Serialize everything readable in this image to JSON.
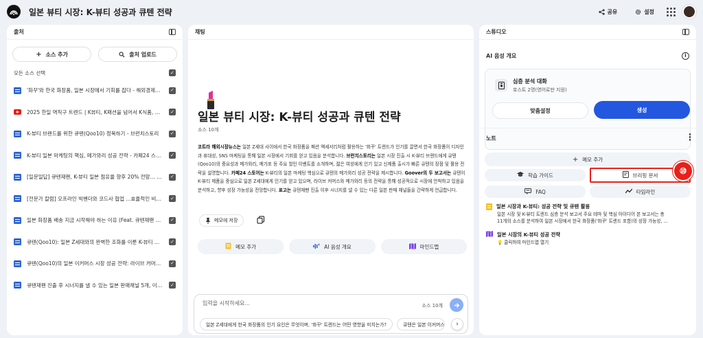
{
  "app": {
    "title": "일본 뷰티 시장: K-뷰티 성공과 큐텐 전략",
    "share_label": "공유",
    "settings_label": "설정"
  },
  "sources": {
    "header": "출처",
    "add_label": "소스 추가",
    "upload_label": "출처 업로드",
    "select_all": "모든 소스 선택",
    "items": [
      {
        "type": "doc",
        "label": "'화꾸'와 한국 화장품, 일본 시장에서 기회를 잡다 - 해외경제정..."
      },
      {
        "type": "youtube",
        "label": "2025 한일 역직구 트렌드 | K뷰티, K패션을 넘어서 K식품, K세..."
      },
      {
        "type": "doc",
        "label": "K-뷰티 브랜드를 위한 큐텐(Qoo10) 정복하기 - 브런치스토리"
      },
      {
        "type": "doc",
        "label": "K-뷰티 일본 마케팅의 핵심, 메가와리 성공 전략 - 카페24 스토..."
      },
      {
        "type": "doc",
        "label": "[일문일답] 큐텐재팬, K-뷰티 일본 점유율 향후 20% 전망... 인..."
      },
      {
        "type": "doc",
        "label": "[전문가 칼럼] 오프라인 빅벤더와 코드사 협업 ...효율적인 비..."
      },
      {
        "type": "doc",
        "label": "일본 화장품 배송 지금 시작해야 하는 이유 (Feat. 큐텐재팬 배..."
      },
      {
        "type": "doc",
        "label": "큐텐(Qoo10): 일본 Z세대와의 완벽한 조화를 이룬 K-뷰티 라..."
      },
      {
        "type": "doc",
        "label": "큐텐(Qoo10)의 일본 이커머스 시장 성공 전략: 라이브 커머스..."
      },
      {
        "type": "doc",
        "label": "큐텐재팬 진출 후 시너지를 낼 수 있는 일본 판매채널 5개, 이 ..."
      }
    ]
  },
  "chat": {
    "header": "채팅",
    "doc_title": "일본 뷰티 시장: K-뷰티 성공과 큐텐 전략",
    "doc_count": "소스 10개",
    "summary_parts": [
      {
        "b": "코트라 해외시장뉴스는",
        "t": " 일본 Z세대 사이에서 한국 화장품을 패션 액세서리처럼 활용하는 '화꾸' 트렌드가 인기를 끌면서 한국 화장품이 디자인과 휴대성, SNS 마케팅을 통해 일본 시장에서 기회를 얻고 있음을 분석합니다. "
      },
      {
        "b": "브런치스토리는",
        "t": " 일본 시장 진출 시 K-뷰티 브랜드에게 큐텐(Qoo10)의 중요성과 메가와리, 메가포 등 주요 할인 이벤트를 소개하며, 젊은 여성에게 인기 있고 신제품 출시가 빠른 큐텐의 장점 및 활용 전략을 설명합니다. "
      },
      {
        "b": "카페24 스토어는",
        "t": " K-뷰티의 일본 마케팅 핵심으로 큐텐의 메가와리 성공 전략을 제시합니다. "
      },
      {
        "b": "Goover의 두 보고서는",
        "t": " 큐텐이 K-뷰티 제품을 중심으로 일본 Z세대에게 인기를 얻고 있으며, 라이브 커머스와 메가와리 등의 전략을 통해 성공적으로 시장에 안착하고 있음을 분석하고, 향후 성장 가능성을 전망합니다. "
      },
      {
        "b": "표고는",
        "t": " 큐텐재팬 진출 이후 시너지를 낼 수 있는 다른 일본 판매 채널들을 간략하게 언급합니다."
      }
    ],
    "memo_save_label": "메모에 저장",
    "actions": [
      {
        "icon": "note",
        "label": "메모 추가"
      },
      {
        "icon": "audio",
        "label": "AI 음성 개요"
      },
      {
        "icon": "mindmap",
        "label": "마인드맵"
      }
    ],
    "input_placeholder": "입력을 시작하세요...",
    "input_source_count": "소스 10개",
    "suggestions": [
      "일본 Z세대에게 한국 화장품의 인기 요인은 무엇이며, '화꾸' 트렌드는 어떤 영향을 미치는가?",
      "큐텐은 일본 이커머스"
    ]
  },
  "studio": {
    "header": "스튜디오",
    "audio_title": "AI 음성 개요",
    "card_title": "심층 분석 대화",
    "card_sub": "호스트 2명(영어로만 지원)",
    "custom_label": "맞춤설정",
    "generate_label": "생성",
    "notes_title": "노트",
    "add_memo_label": "메모 추가",
    "note_buttons": [
      {
        "icon": "grad",
        "label": "학습 가이드"
      },
      {
        "icon": "doc",
        "label": "브리핑 문서",
        "highlight": true
      },
      {
        "icon": "faq",
        "label": "FAQ"
      },
      {
        "icon": "timeline",
        "label": "타임라인"
      }
    ],
    "badge": "⑩",
    "notes": [
      {
        "title": "일본 시장과 K-뷰티: 성공 전략 및 큐텐 활용",
        "body": [
          "일본 시장 및 K-뷰티 트렌드 심층 분석 보고서 주요 테마 및 핵심 아이디어 본 보고서는 총",
          "11개의 소스를 분석하여 일본 시장에서 한국 화장품('화꾸' 트렌드 포함)의 성장 가능성, ..."
        ]
      },
      {
        "title": "일본 시장의 K-뷰티 성공 전략",
        "body": [
          "💡 클릭하여 마인드맵 열기"
        ]
      }
    ]
  }
}
